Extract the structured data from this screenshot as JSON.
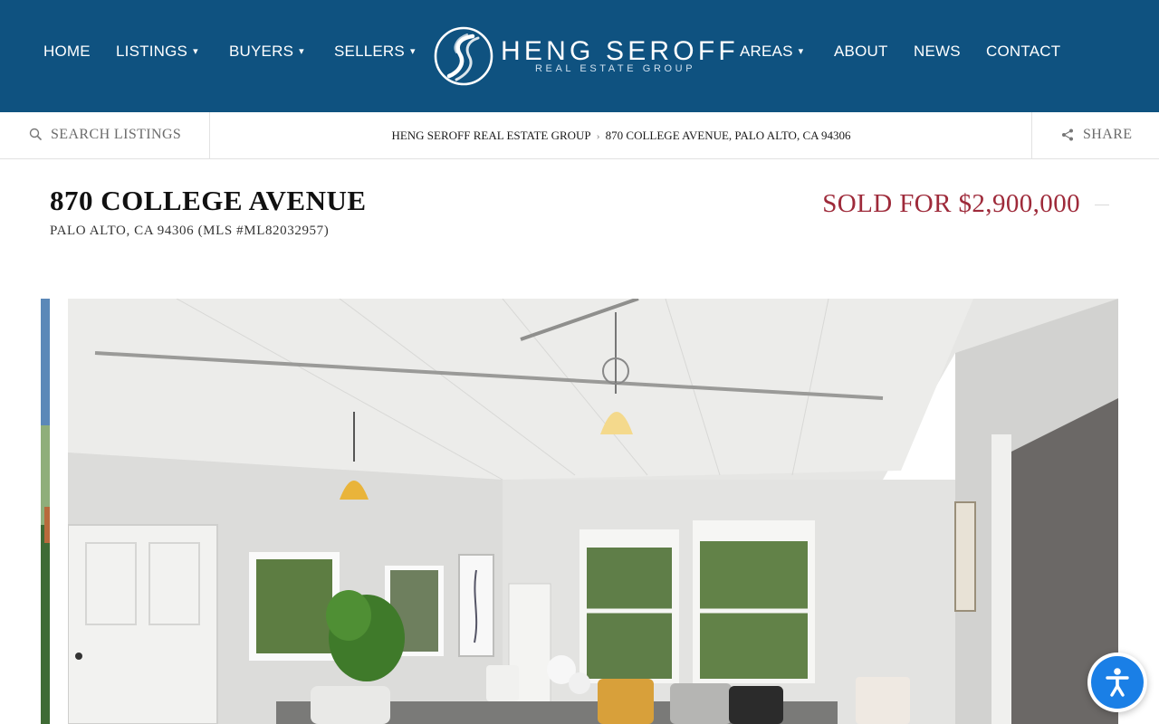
{
  "nav": {
    "left": [
      {
        "label": "HOME",
        "caret": false
      },
      {
        "label": "LISTINGS",
        "caret": true
      },
      {
        "label": "BUYERS",
        "caret": true
      },
      {
        "label": "SELLERS",
        "caret": true
      }
    ],
    "right": [
      {
        "label": "AREAS",
        "caret": true
      },
      {
        "label": "ABOUT",
        "caret": false
      },
      {
        "label": "NEWS",
        "caret": false
      },
      {
        "label": "CONTACT",
        "caret": false
      }
    ],
    "caret_glyph": "▾"
  },
  "logo": {
    "wordmark": "HENG SEROFF",
    "tagline": "REAL ESTATE GROUP",
    "icon": "hs-monogram-icon"
  },
  "subbar": {
    "search_label": "SEARCH LISTINGS",
    "search_icon": "search-icon",
    "breadcrumb": {
      "home": "HENG SEROFF REAL ESTATE GROUP",
      "separator": "›",
      "current": "870 COLLEGE AVENUE, PALO ALTO, CA 94306"
    },
    "share_label": "SHARE",
    "share_icon": "share-icon"
  },
  "listing": {
    "address": "870 COLLEGE AVENUE",
    "location": "PALO ALTO, CA 94306 (MLS #ML82032957)",
    "price": "SOLD FOR $2,900,000"
  },
  "gallery": {
    "photo": "living-room-photo"
  },
  "accessibility": {
    "icon": "accessibility-icon"
  },
  "colors": {
    "header_bg": "#0f5280",
    "sold_text": "#9e2a3a",
    "accessibility_bg": "#1a7fe6"
  }
}
